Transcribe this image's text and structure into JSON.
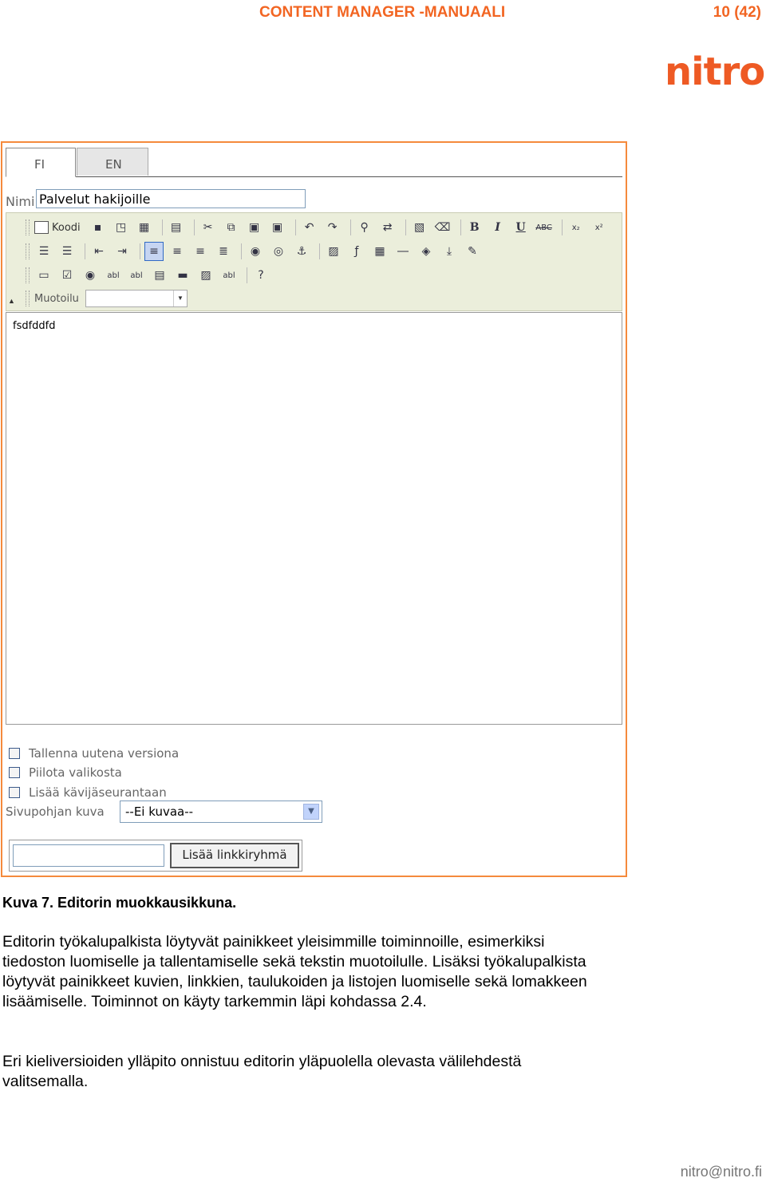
{
  "header": {
    "title": "CONTENT MANAGER -MANUAALI",
    "page": "10 (42)",
    "logo_text": "nitro",
    "accent_color": "#f26522"
  },
  "screenshot": {
    "tabs": [
      {
        "label": "FI",
        "active": true
      },
      {
        "label": "EN",
        "active": false
      }
    ],
    "name_label": "Nimi",
    "name_value": "Palvelut hakijoille",
    "toolbar": {
      "koodi_label": "Koodi",
      "row1_icons": [
        "save-icon",
        "preview-icon",
        "templates-icon",
        "new-page-icon",
        "cut-icon",
        "copy-icon",
        "paste-icon",
        "paste-word-icon",
        "undo-icon",
        "redo-icon",
        "find-icon",
        "replace-icon",
        "select-all-icon",
        "remove-format-icon"
      ],
      "bold": "B",
      "italic": "I",
      "underline": "U",
      "strike": "ABC",
      "subscript": "x₂",
      "superscript": "x²",
      "row2_icons": [
        "ordered-list-icon",
        "unordered-list-icon",
        "outdent-icon",
        "indent-icon",
        "align-left-icon",
        "align-center-icon",
        "align-right-icon",
        "justify-icon",
        "link-icon",
        "unlink-icon",
        "anchor-icon",
        "image-icon",
        "flash-icon",
        "table-icon",
        "horizontal-rule-icon",
        "special-char-icon",
        "page-break-icon",
        "smiley-icon"
      ],
      "row3_icons": [
        "form-icon",
        "checkbox-icon",
        "radio-icon",
        "textfield-icon",
        "textarea-icon",
        "select-icon",
        "button-icon",
        "image-button-icon",
        "hidden-field-icon",
        "about-icon"
      ],
      "row3_labels": {
        "textfield": "abl",
        "textarea": "abl",
        "hidden": "abl",
        "about": "?"
      },
      "muotoilu_label": "Muotoilu",
      "muotoilu_value": ""
    },
    "editor_content": "fsdfddfd",
    "checkboxes": [
      {
        "label": "Tallenna uutena versiona",
        "checked": false
      },
      {
        "label": "Piilota valikosta",
        "checked": false
      },
      {
        "label": "Lisää kävijäseurantaan",
        "checked": false
      }
    ],
    "kuva_label": "Sivupohjan kuva",
    "kuva_value": "--Ei kuvaa--",
    "link_group_input": "",
    "link_group_button": "Lisää linkkiryhmä"
  },
  "caption": "Kuva 7. Editorin muokkausikkuna.",
  "paragraphs": [
    "Editorin työkalupalkista löytyvät painikkeet yleisimmille toiminnoille, esimerkiksi tiedoston luomiselle ja tallentamiselle sekä tekstin muotoilulle. Lisäksi työkalupalkista löytyvät painikkeet kuvien, linkkien, taulukoiden ja listojen luomiselle sekä lomakkeen lisäämiselle. Toiminnot on käyty tarkemmin läpi kohdassa 2.4.",
    "Eri kieliversioiden ylläpito onnistuu editorin yläpuolella olevasta välilehdestä valitsemalla."
  ],
  "footer": "nitro@nitro.fi"
}
